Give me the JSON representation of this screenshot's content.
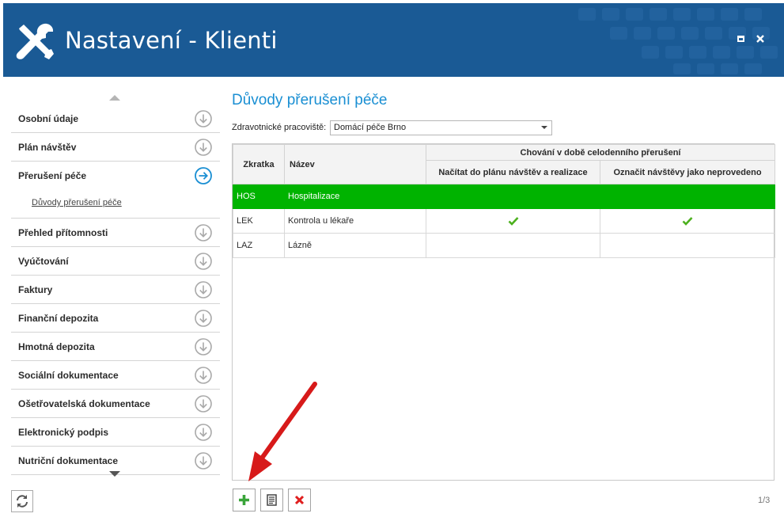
{
  "window": {
    "title": "Nastavení - Klienti"
  },
  "colors": {
    "header_bg": "#1a5a95",
    "accent": "#1a8fd3",
    "selected_row": "#00b300",
    "check": "#4cb01e",
    "delete": "#e01f1f",
    "annotation_arrow": "#d71a1a"
  },
  "sidebar": {
    "items": [
      {
        "label": "Osobní údaje"
      },
      {
        "label": "Plán návštěv"
      },
      {
        "label": "Přerušení péče",
        "active": true,
        "sub": "Důvody přerušení péče"
      },
      {
        "label": "Přehled přítomnosti"
      },
      {
        "label": "Vyúčtování"
      },
      {
        "label": "Faktury"
      },
      {
        "label": "Finanční depozita"
      },
      {
        "label": "Hmotná depozita"
      },
      {
        "label": "Sociální dokumentace"
      },
      {
        "label": "Ošetřovatelská dokumentace"
      },
      {
        "label": "Elektronický podpis"
      },
      {
        "label": "Nutriční dokumentace"
      }
    ]
  },
  "main": {
    "title": "Důvody přerušení péče",
    "workplace_label": "Zdravotnické pracoviště:",
    "workplace_value": "Domácí péče Brno",
    "grid": {
      "col_code": "Zkratka",
      "col_name": "Název",
      "group_header": "Chování v době celodenního přerušení",
      "col_load": "Načítat do plánu návštěv a realizace",
      "col_mark": "Označit návštěvy jako neprovedeno",
      "rows": [
        {
          "code": "HOS",
          "name": "Hospitalizace",
          "load": false,
          "mark": false,
          "selected": true
        },
        {
          "code": "LEK",
          "name": "Kontrola u lékaře",
          "load": true,
          "mark": true,
          "selected": false
        },
        {
          "code": "LAZ",
          "name": "Lázně",
          "load": false,
          "mark": false,
          "selected": false
        }
      ]
    },
    "pager": "1/3"
  },
  "icons": {
    "header": "tools-icon",
    "nav_collapsed": "circle-arrow-down-icon",
    "nav_active": "circle-arrow-right-icon",
    "refresh": "refresh-icon",
    "add": "plus-icon",
    "detail": "document-icon",
    "delete": "close-icon",
    "row_check": "check-icon"
  }
}
